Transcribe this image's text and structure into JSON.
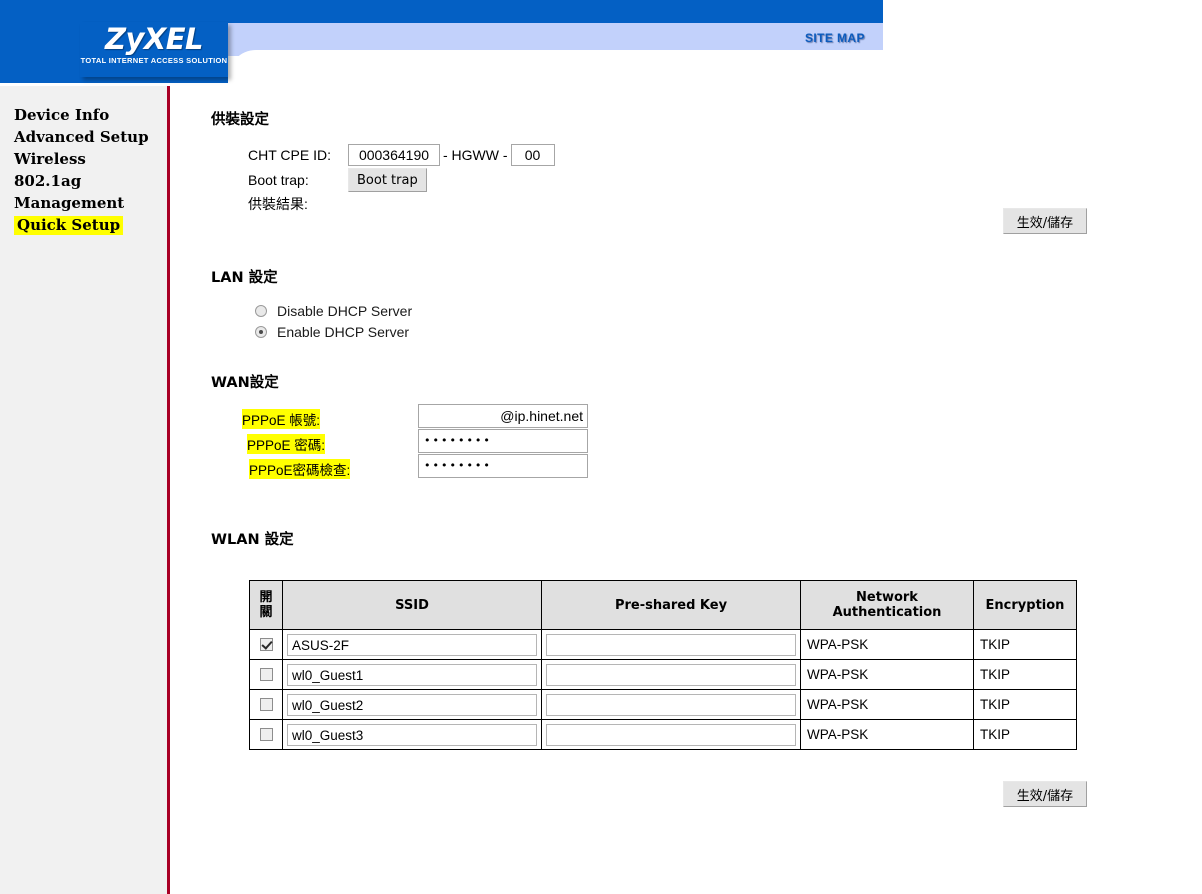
{
  "header": {
    "logo_word": "ZyXEL",
    "logo_tagline": "TOTAL INTERNET ACCESS SOLUTION",
    "site_map_label": "SITE MAP",
    "colors": {
      "brand_blue": "#0460c4",
      "band_light_blue": "#c2d1fb",
      "sidebar_border_red": "#a90026",
      "highlight_yellow": "#ffff00"
    }
  },
  "sidebar": {
    "items": [
      {
        "label": "Device Info",
        "highlighted": false
      },
      {
        "label": "Advanced Setup",
        "highlighted": false
      },
      {
        "label": "Wireless",
        "highlighted": false
      },
      {
        "label": "802.1ag",
        "highlighted": false
      },
      {
        "label": "Management",
        "highlighted": false
      },
      {
        "label": "Quick Setup",
        "highlighted": true
      }
    ]
  },
  "supply": {
    "title": "供裝設定",
    "cpe_id_label": "CHT CPE ID:",
    "cpe_id_value": "000364190",
    "cpe_middle_text": "- HGWW -",
    "cpe_suffix_value": "00",
    "boot_trap_label": "Boot trap:",
    "boot_trap_button": "Boot trap",
    "result_label": "供裝結果:",
    "result_value": ""
  },
  "lan": {
    "title": "LAN 設定",
    "options": [
      {
        "label": "Disable DHCP Server",
        "selected": false
      },
      {
        "label": "Enable DHCP Server",
        "selected": true
      }
    ]
  },
  "wan": {
    "title": "WAN設定",
    "fields": [
      {
        "label": "PPPoE 帳號:",
        "value": "@ip.hinet.net",
        "type": "text",
        "highlighted": true
      },
      {
        "label": "PPPoE 密碼:",
        "value": "••••••••",
        "type": "password",
        "highlighted": true
      },
      {
        "label": "PPPoE密碼檢查:",
        "value": "••••••••",
        "type": "password",
        "highlighted": true
      }
    ]
  },
  "wlan": {
    "title": "WLAN 設定",
    "columns": {
      "onoff_line1": "開",
      "onoff_line2": "關",
      "ssid": "SSID",
      "psk": "Pre-shared Key",
      "auth_line1": "Network",
      "auth_line2": "Authentication",
      "encryption": "Encryption"
    },
    "rows": [
      {
        "enabled": true,
        "ssid": "ASUS-2F",
        "psk": "",
        "auth": "WPA-PSK",
        "encryption": "TKIP"
      },
      {
        "enabled": false,
        "ssid": "wl0_Guest1",
        "psk": "",
        "auth": "WPA-PSK",
        "encryption": "TKIP"
      },
      {
        "enabled": false,
        "ssid": "wl0_Guest2",
        "psk": "",
        "auth": "WPA-PSK",
        "encryption": "TKIP"
      },
      {
        "enabled": false,
        "ssid": "wl0_Guest3",
        "psk": "",
        "auth": "WPA-PSK",
        "encryption": "TKIP"
      }
    ]
  },
  "buttons": {
    "save_top": "生效/儲存",
    "save_bottom": "生效/儲存"
  }
}
